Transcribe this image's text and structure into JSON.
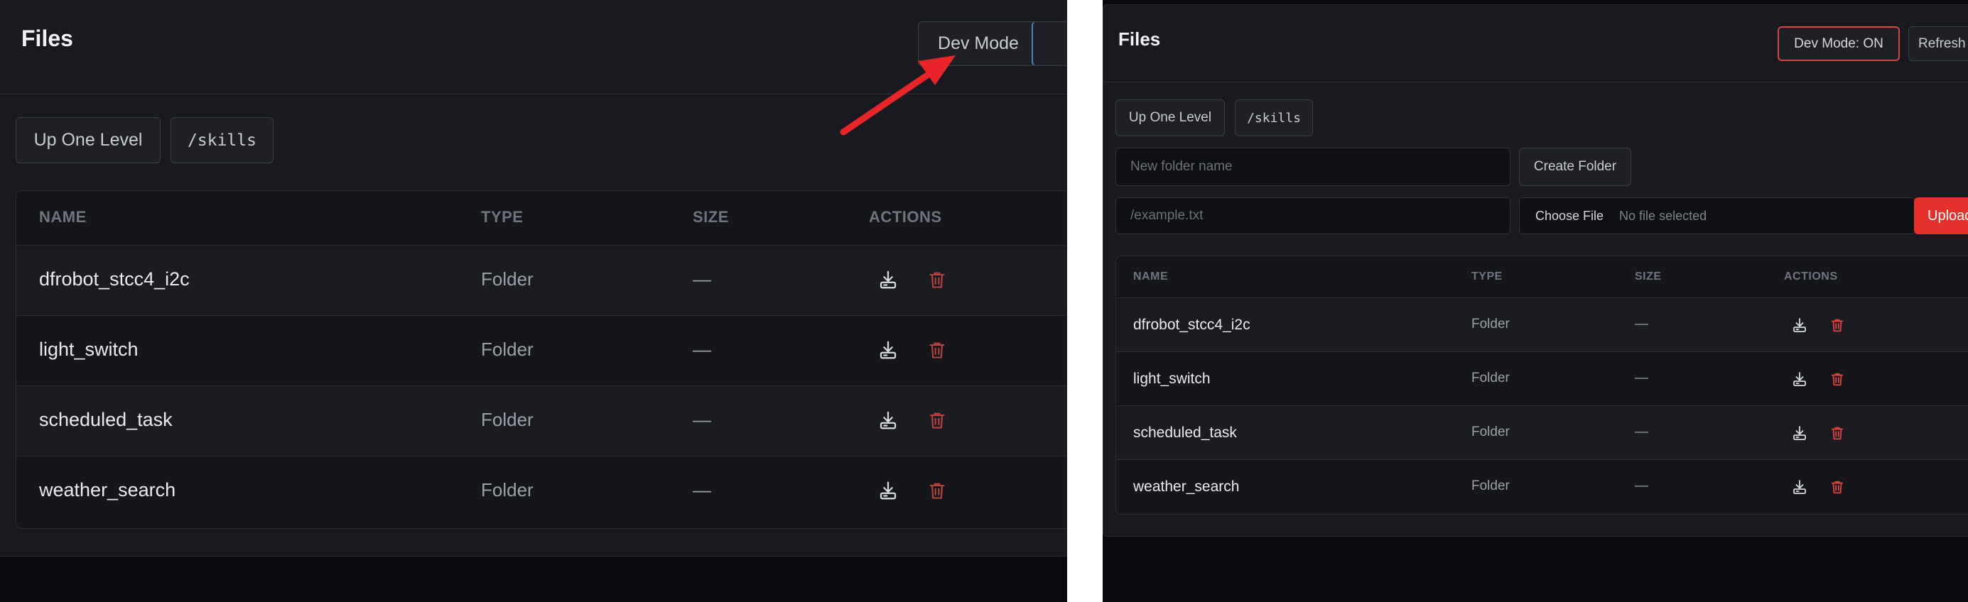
{
  "left": {
    "title": "Files",
    "dev_mode_label": "Dev Mode",
    "up_one_level_label": "Up One Level",
    "path": "/skills",
    "columns": [
      "NAME",
      "TYPE",
      "SIZE",
      "ACTIONS"
    ],
    "rows": [
      {
        "name": "dfrobot_stcc4_i2c",
        "type": "Folder",
        "size": "—"
      },
      {
        "name": "light_switch",
        "type": "Folder",
        "size": "—"
      },
      {
        "name": "scheduled_task",
        "type": "Folder",
        "size": "—"
      },
      {
        "name": "weather_search",
        "type": "Folder",
        "size": "—"
      }
    ]
  },
  "right": {
    "title": "Files",
    "dev_mode_label": "Dev Mode: ON",
    "refresh_label": "Refresh",
    "up_one_level_label": "Up One Level",
    "path": "/skills",
    "new_folder_placeholder": "New folder name",
    "create_folder_label": "Create Folder",
    "upload_path_placeholder": "/example.txt",
    "choose_file_label": "Choose File",
    "no_file_label": "No file selected",
    "upload_label": "Upload",
    "columns": [
      "NAME",
      "TYPE",
      "SIZE",
      "ACTIONS"
    ],
    "rows": [
      {
        "name": "dfrobot_stcc4_i2c",
        "type": "Folder",
        "size": "—"
      },
      {
        "name": "light_switch",
        "type": "Folder",
        "size": "—"
      },
      {
        "name": "scheduled_task",
        "type": "Folder",
        "size": "—"
      },
      {
        "name": "weather_search",
        "type": "Folder",
        "size": "—"
      }
    ]
  },
  "colors": {
    "background": "#0a0b0e",
    "card": "#181a1f",
    "delete_icon": "#d9534f",
    "dev_mode_on_border": "#d64545",
    "upload_button": "#e5322d",
    "annotation_arrow": "#e8262a"
  },
  "icons": {
    "download": "download-icon",
    "delete": "trash-icon"
  }
}
